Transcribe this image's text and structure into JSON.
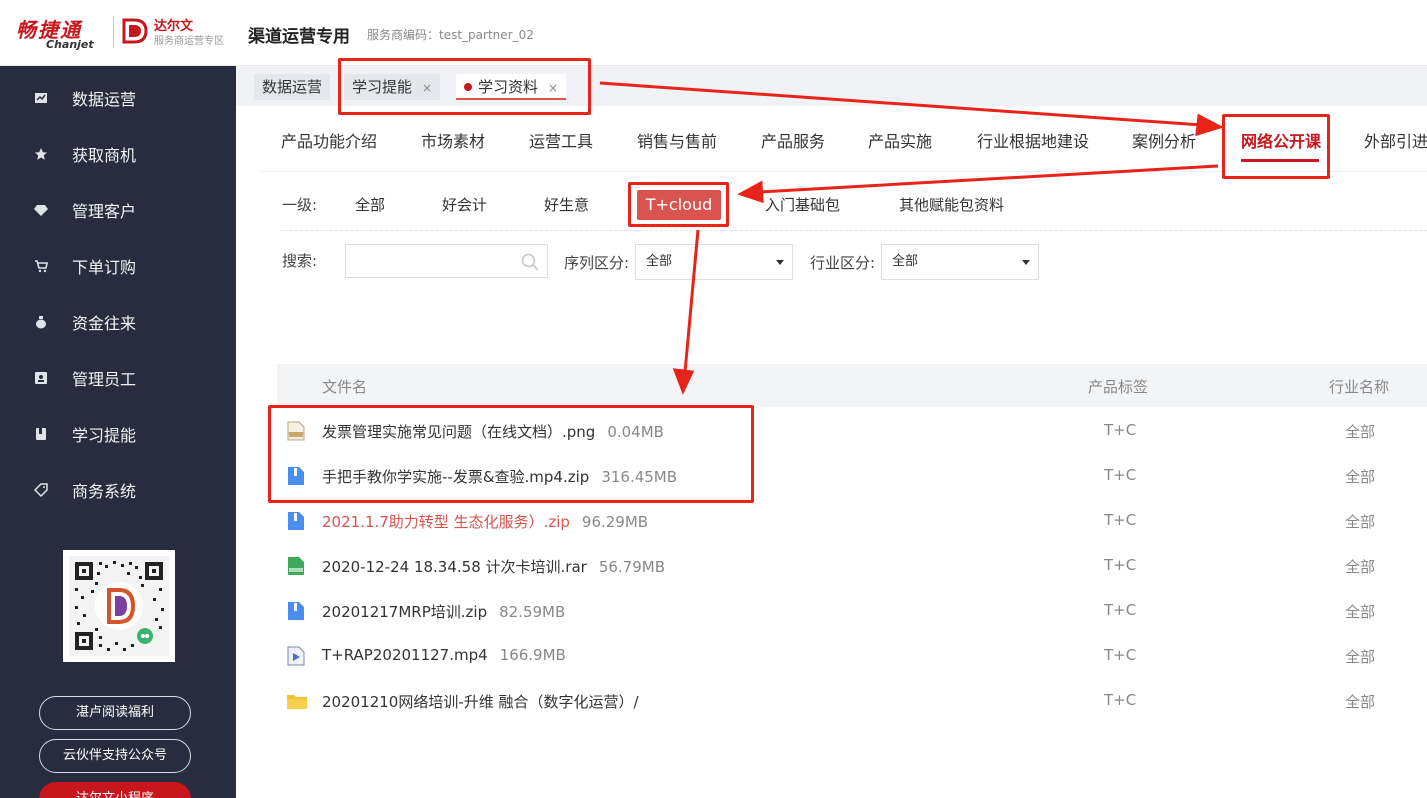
{
  "header": {
    "brand_main": "畅捷通",
    "brand_sub": "Chanjet",
    "darwin_name": "达尔文",
    "darwin_sub": "服务商运营专区",
    "title": "渠道运营专用",
    "partner_code": "服务商编码：test_partner_02"
  },
  "sidebar": {
    "items": [
      {
        "label": "数据运营",
        "icon": "chart-icon"
      },
      {
        "label": "获取商机",
        "icon": "star-icon"
      },
      {
        "label": "管理客户",
        "icon": "diamond-icon"
      },
      {
        "label": "下单订购",
        "icon": "cart-icon"
      },
      {
        "label": "资金往来",
        "icon": "money-bag-icon"
      },
      {
        "label": "管理员工",
        "icon": "id-card-icon"
      },
      {
        "label": "学习提能",
        "icon": "book-icon"
      },
      {
        "label": "商务系统",
        "icon": "tag-icon"
      }
    ],
    "buttons": [
      "湛卢阅读福利",
      "云伙伴支持公众号",
      "达尔文小程序"
    ]
  },
  "page_tabs": [
    {
      "label": "数据运营"
    },
    {
      "label": "学习提能",
      "close": "×"
    },
    {
      "label": "学习资料",
      "close": "×"
    }
  ],
  "category_tabs": [
    "产品功能介绍",
    "市场素材",
    "运营工具",
    "销售与售前",
    "产品服务",
    "产品实施",
    "行业根据地建设",
    "案例分析",
    "网络公开课",
    "外部引进"
  ],
  "filters": {
    "level_label": "一级:",
    "levels": [
      "全部",
      "好会计",
      "好生意",
      "T+cloud",
      "入门基础包",
      "其他赋能包资料"
    ],
    "search_label": "搜索:",
    "search_value": "",
    "series_label": "序列区分:",
    "series_value": "全部",
    "industry_label": "行业区分:",
    "industry_value": "全部"
  },
  "table": {
    "columns": [
      "文件名",
      "产品标签",
      "行业名称"
    ],
    "rows": [
      {
        "name": "发票管理实施常见问题（在线文档）.png",
        "size": "0.04MB",
        "tag": "T+C",
        "industry": "全部",
        "type": "png"
      },
      {
        "name": "手把手教你学实施--发票&查验.mp4.zip",
        "size": "316.45MB",
        "tag": "T+C",
        "industry": "全部",
        "type": "zip"
      },
      {
        "name": "2021.1.7助力转型 生态化服务）.zip",
        "size": "96.29MB",
        "tag": "T+C",
        "industry": "全部",
        "type": "zip"
      },
      {
        "name": "2020-12-24 18.34.58 计次卡培训.rar",
        "size": "56.79MB",
        "tag": "T+C",
        "industry": "全部",
        "type": "rar"
      },
      {
        "name": "20201217MRP培训.zip",
        "size": "82.59MB",
        "tag": "T+C",
        "industry": "全部",
        "type": "zip"
      },
      {
        "name": "T+RAP20201127.mp4",
        "size": "166.9MB",
        "tag": "T+C",
        "industry": "全部",
        "type": "mp4"
      },
      {
        "name": "20201210网络培训-升维 融合（数字化运营）/",
        "size": "",
        "tag": "T+C",
        "industry": "全部",
        "type": "folder"
      }
    ]
  },
  "colors": {
    "brand_red": "#c8161d",
    "sidebar_bg": "#272d3e",
    "annotation_red": "#e8231a",
    "selected_level_bg": "#d9534f"
  }
}
